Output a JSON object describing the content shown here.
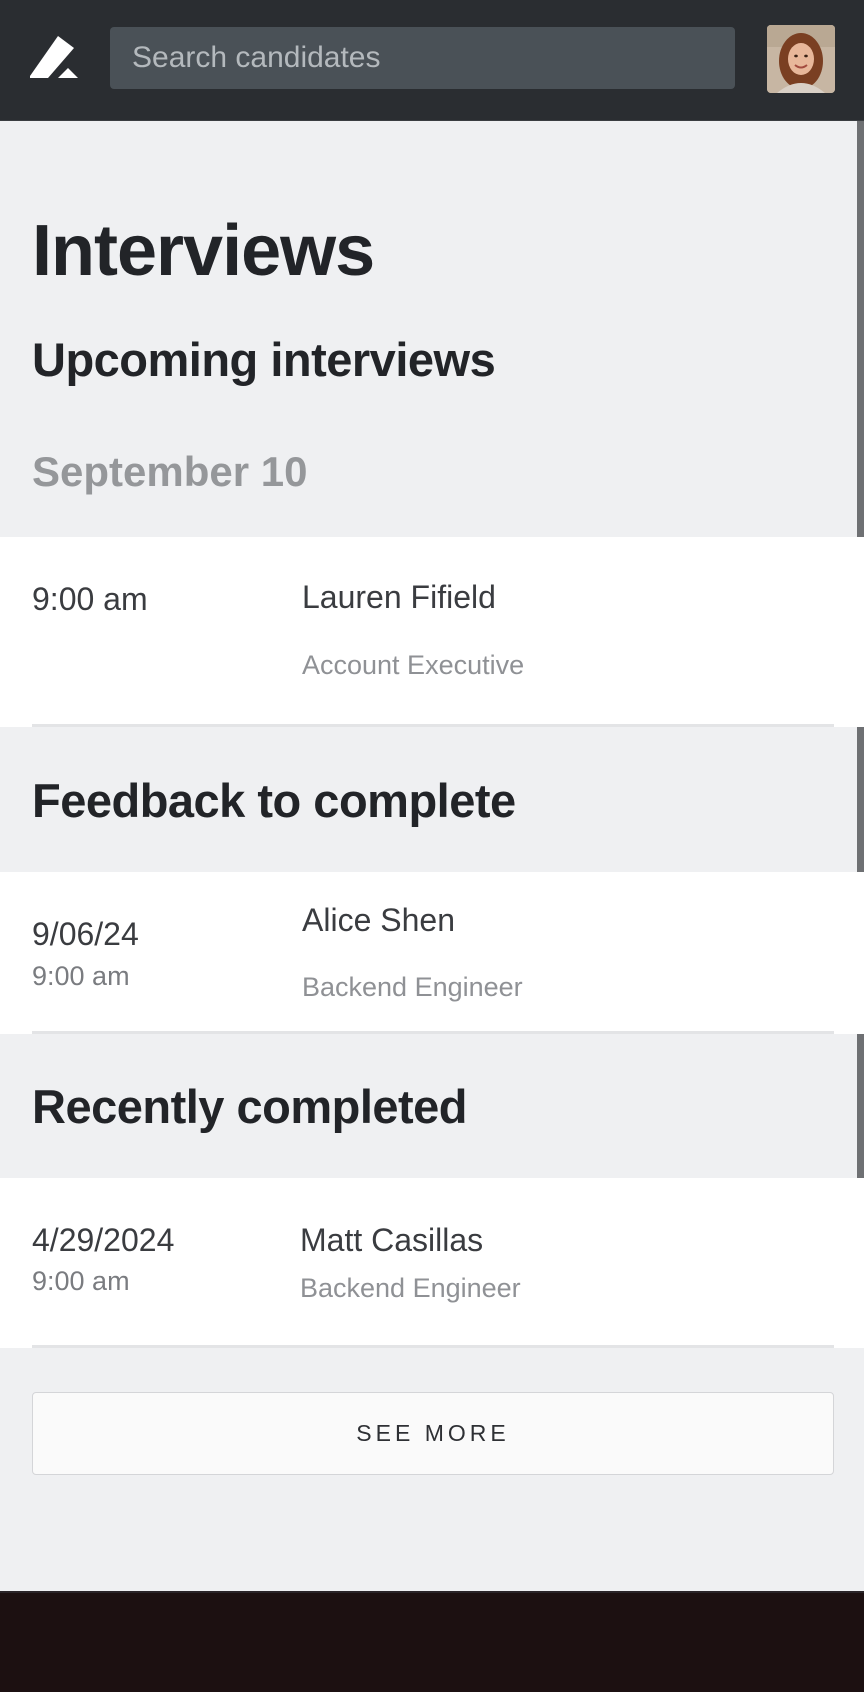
{
  "header": {
    "search_placeholder": "Search candidates",
    "logo_icon": "pen-logo-icon",
    "avatar": "user-avatar"
  },
  "page": {
    "title": "Interviews"
  },
  "upcoming": {
    "title": "Upcoming interviews",
    "date": "September 10",
    "items": [
      {
        "time": "9:00 am",
        "name": "Lauren Fifield",
        "role": "Account Executive"
      }
    ]
  },
  "feedback": {
    "title": "Feedback to complete",
    "items": [
      {
        "date": "9/06/24",
        "time": "9:00 am",
        "name": "Alice Shen",
        "role": "Backend Engineer"
      }
    ]
  },
  "completed": {
    "title": "Recently completed",
    "items": [
      {
        "date": "4/29/2024",
        "time": "9:00 am",
        "name": "Matt Casillas",
        "role": "Backend Engineer"
      }
    ]
  },
  "see_more_label": "SEE MORE",
  "colors": {
    "header_bg": "#2a2d31",
    "search_bg": "#4a5157",
    "page_bg": "#eff0f2",
    "card_bg": "#ffffff",
    "footer_bg": "#1c1011"
  }
}
